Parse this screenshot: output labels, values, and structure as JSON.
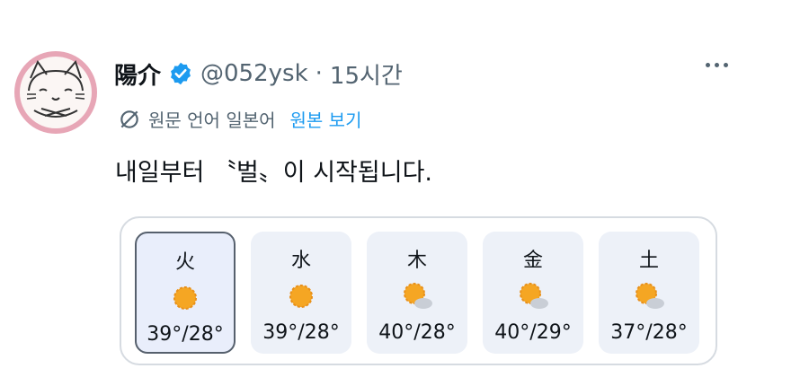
{
  "tweet": {
    "display_name": "陽介",
    "handle": "@052ysk",
    "separator": "·",
    "time": "15시간",
    "translation_note": "원문 언어 일본어",
    "show_original_label": "원본 보기",
    "text": "내일부터 〝벌〟이 시작됩니다."
  },
  "weather": {
    "days": [
      {
        "label": "火",
        "temp": "39°/28°",
        "icon": "sun-icon",
        "selected": true
      },
      {
        "label": "水",
        "temp": "39°/28°",
        "icon": "sun-icon",
        "selected": false
      },
      {
        "label": "木",
        "temp": "40°/28°",
        "icon": "sun-cloud-icon",
        "selected": false
      },
      {
        "label": "金",
        "temp": "40°/29°",
        "icon": "sun-cloud-icon",
        "selected": false
      },
      {
        "label": "土",
        "temp": "37°/28°",
        "icon": "sun-cloud-icon",
        "selected": false
      }
    ]
  },
  "colors": {
    "verified": "#1d9bf0",
    "link": "#1d9bf0",
    "sun": "#f5a623",
    "avatar_bg": "#e7a6b6"
  }
}
